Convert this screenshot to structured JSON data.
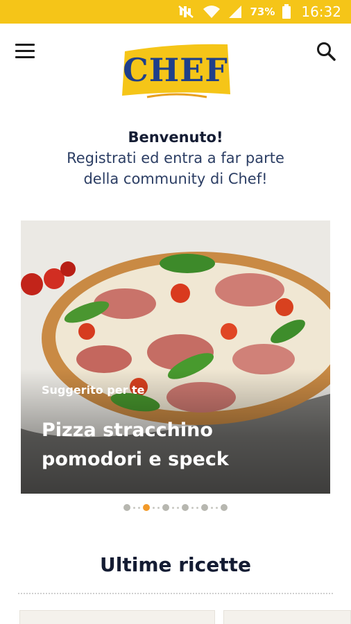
{
  "status_bar": {
    "battery_percent": "73%",
    "time": "16:32",
    "icons": [
      "mute-icon",
      "wifi-icon",
      "signal-icon",
      "battery-icon"
    ]
  },
  "header": {
    "logo_text": "CHEF",
    "menu_icon": "hamburger-menu-icon",
    "search_icon": "search-icon"
  },
  "welcome": {
    "title": "Benvenuto!",
    "line1": "Registrati ed entra a far parte",
    "line2": "della community di Chef!"
  },
  "carousel": {
    "tag": "Suggerito per te",
    "title_line1": "Pizza stracchino",
    "title_line2": "pomodori e speck",
    "slide_count": 6,
    "active_index": 1
  },
  "section": {
    "title": "Ultime ricette"
  },
  "colors": {
    "brand_yellow": "#f5c518",
    "brand_blue": "#1f3f8a",
    "active_dot": "#f29a2a",
    "text_dark": "#141c33"
  }
}
